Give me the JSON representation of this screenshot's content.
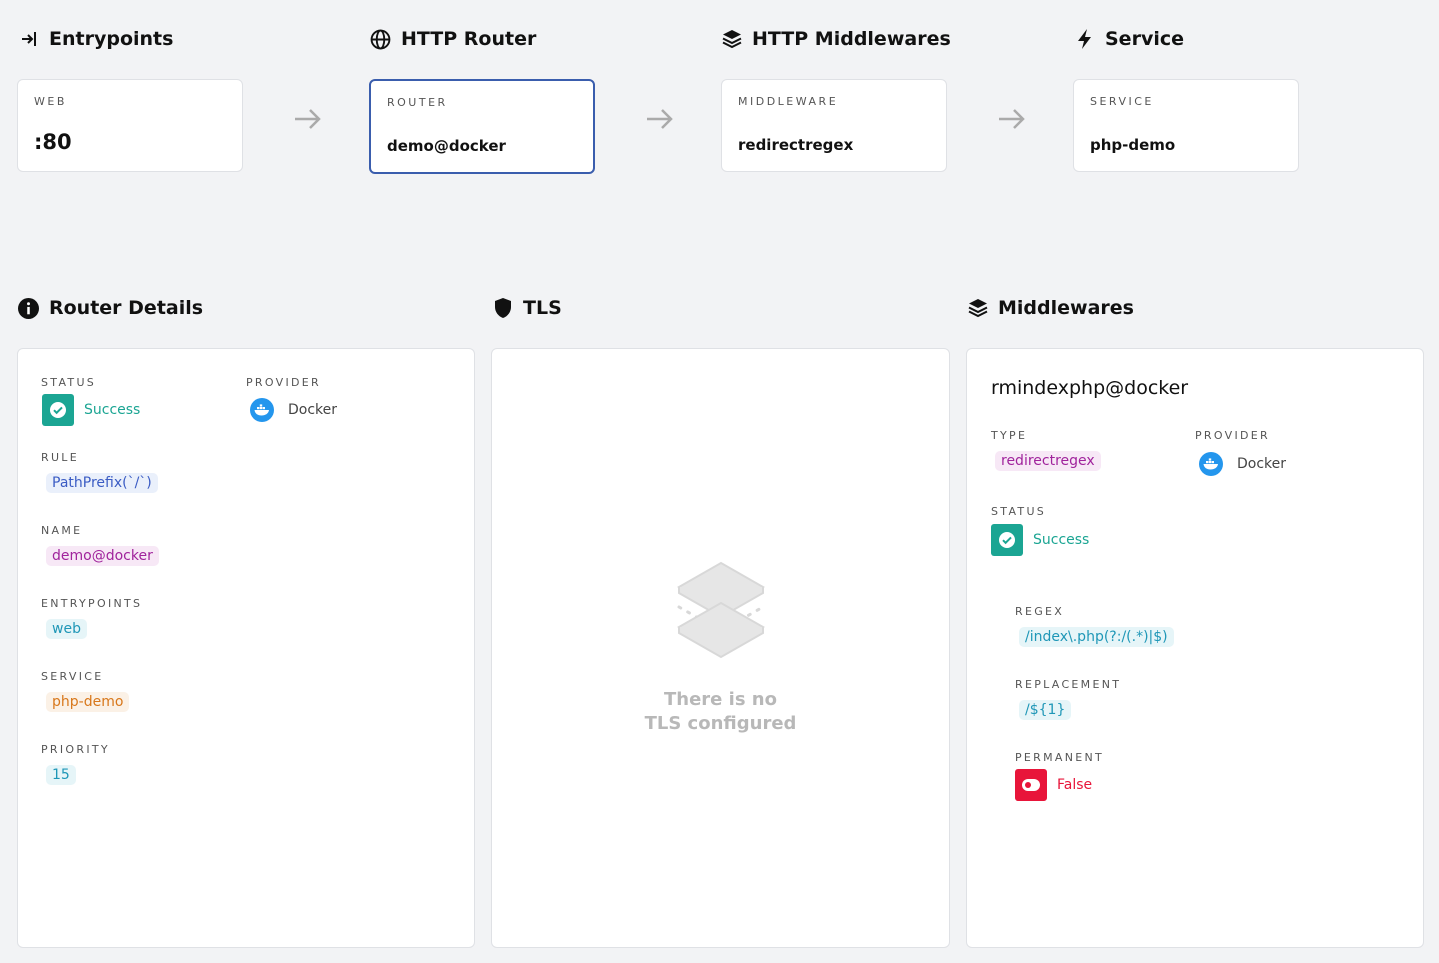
{
  "flow": {
    "entrypoints": {
      "title": "Entrypoints",
      "label": "WEB",
      "value": ":80"
    },
    "router": {
      "title": "HTTP Router",
      "label": "ROUTER",
      "value": "demo@docker"
    },
    "middlewares": {
      "title": "HTTP Middlewares",
      "label": "MIDDLEWARE",
      "value": "redirectregex"
    },
    "service": {
      "title": "Service",
      "label": "SERVICE",
      "value": "php-demo"
    }
  },
  "router_details": {
    "title": "Router Details",
    "status_label": "STATUS",
    "status_value": "Success",
    "provider_label": "PROVIDER",
    "provider_value": "Docker",
    "rule_label": "RULE",
    "rule_value": "PathPrefix(`/`)",
    "name_label": "NAME",
    "name_value": "demo@docker",
    "entrypoints_label": "ENTRYPOINTS",
    "entrypoints_value": "web",
    "service_label": "SERVICE",
    "service_value": "php-demo",
    "priority_label": "PRIORITY",
    "priority_value": "15"
  },
  "tls": {
    "title": "TLS",
    "empty_line1": "There is no",
    "empty_line2": "TLS configured"
  },
  "middlewares": {
    "title": "Middlewares",
    "name": "rmindexphp@docker",
    "type_label": "TYPE",
    "type_value": "redirectregex",
    "provider_label": "PROVIDER",
    "provider_value": "Docker",
    "status_label": "STATUS",
    "status_value": "Success",
    "regex_label": "REGEX",
    "regex_value": "/index\\.php(?:/(.*)|$)",
    "replacement_label": "REPLACEMENT",
    "replacement_value": "/${1}",
    "permanent_label": "PERMANENT",
    "permanent_value": "False"
  },
  "colors": {
    "success": "#1ba593",
    "danger": "#e8153a",
    "active_border": "#3a5dad",
    "docker": "#2496ed"
  }
}
